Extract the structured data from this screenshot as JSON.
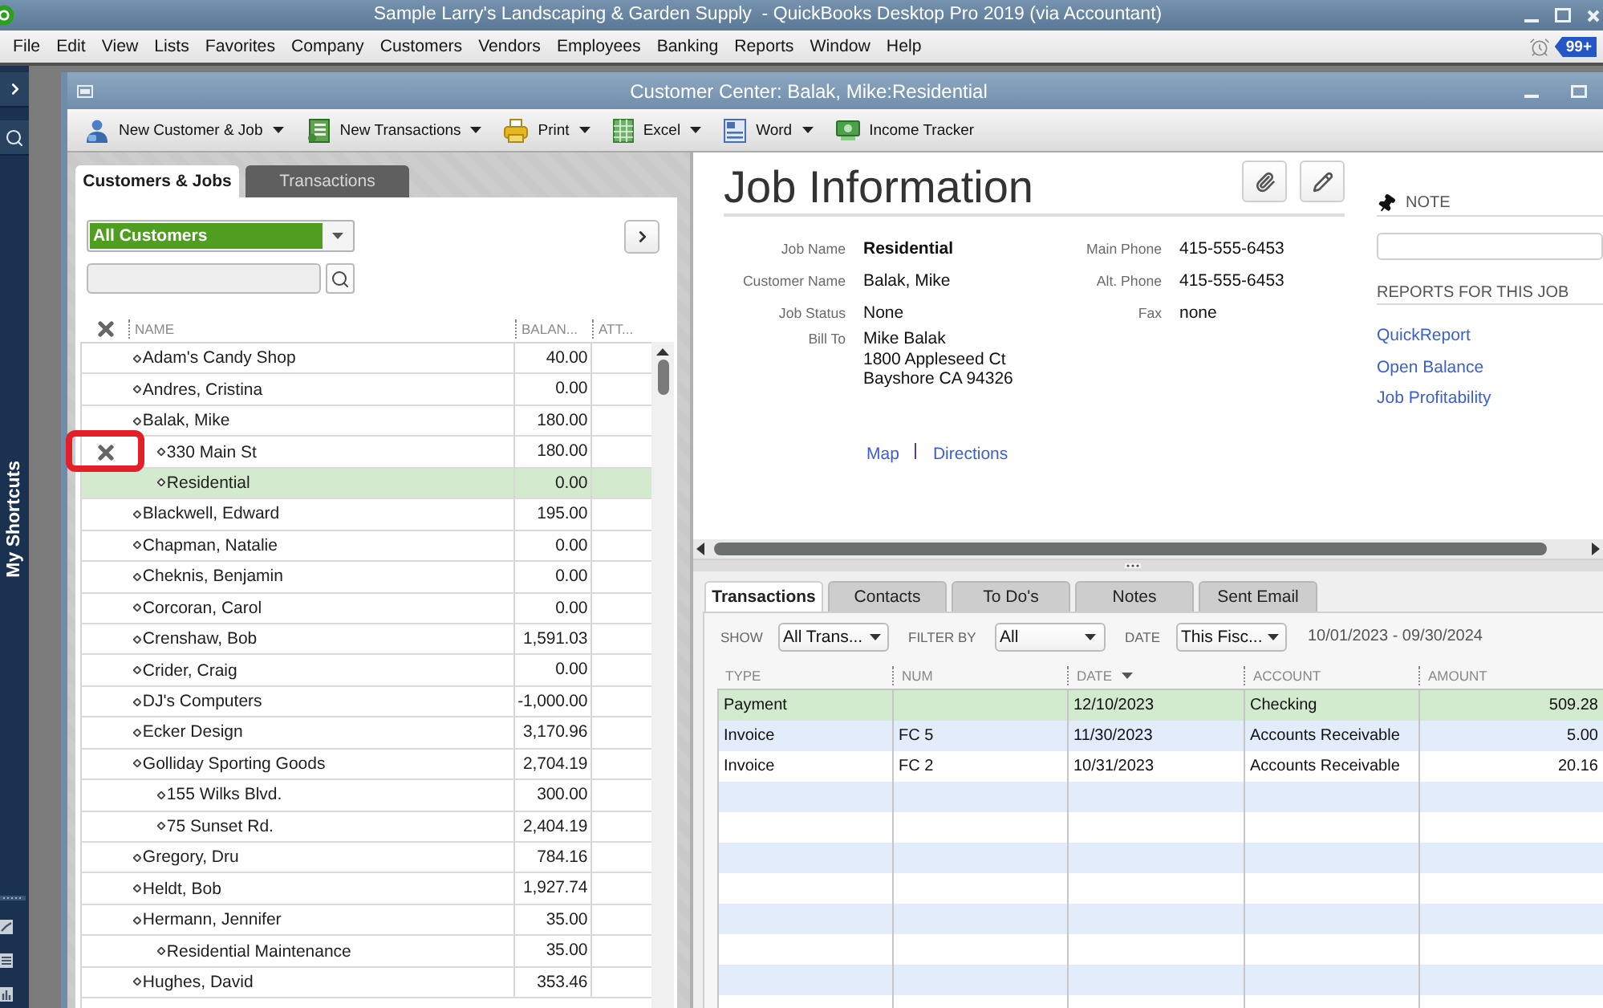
{
  "window": {
    "title": "Sample Larry's Landscaping & Garden Supply  - QuickBooks Desktop Pro 2019 (via Accountant)"
  },
  "menu_bar": {
    "items": [
      "File",
      "Edit",
      "View",
      "Lists",
      "Favorites",
      "Company",
      "Customers",
      "Vendors",
      "Employees",
      "Banking",
      "Reports",
      "Window",
      "Help"
    ],
    "reminders_badge": "99+"
  },
  "shortcuts_panel": {
    "label": "My Shortcuts"
  },
  "customer_center": {
    "title": "Customer Center: Balak, Mike:Residential",
    "toolbar": [
      {
        "kind": "customer",
        "label": "New Customer & Job",
        "dropdown": true
      },
      {
        "kind": "transactions",
        "label": "New Transactions",
        "dropdown": true
      },
      {
        "kind": "print",
        "label": "Print",
        "dropdown": true
      },
      {
        "kind": "excel",
        "label": "Excel",
        "dropdown": true
      },
      {
        "kind": "word",
        "label": "Word",
        "dropdown": true
      },
      {
        "kind": "income",
        "label": "Income Tracker",
        "dropdown": false
      }
    ]
  },
  "list_tabs": [
    {
      "label": "Customers & Jobs",
      "selected": true
    },
    {
      "label": "Transactions",
      "selected": false
    }
  ],
  "customer_filter": {
    "value": "All Customers"
  },
  "customer_table": {
    "columns": [
      "NAME",
      "BALAN...",
      "ATT..."
    ],
    "rows": [
      {
        "name": "Adam's Candy Shop",
        "balance": "40.00",
        "selected": false,
        "inactive": false,
        "marked": false
      },
      {
        "name": "Andres, Cristina",
        "balance": "0.00",
        "selected": false,
        "inactive": false,
        "marked": false
      },
      {
        "name": "Balak, Mike",
        "balance": "180.00",
        "selected": false,
        "inactive": false,
        "marked": false,
        "children": [
          {
            "name": "330 Main St",
            "balance": "180.00",
            "selected": false,
            "inactive": true,
            "marked": true
          },
          {
            "name": "Residential",
            "balance": "0.00",
            "selected": true,
            "inactive": false,
            "marked": false
          }
        ]
      },
      {
        "name": "Blackwell, Edward",
        "balance": "195.00",
        "selected": false,
        "inactive": false,
        "marked": false
      },
      {
        "name": "Chapman, Natalie",
        "balance": "0.00",
        "selected": false,
        "inactive": false,
        "marked": false
      },
      {
        "name": "Cheknis, Benjamin",
        "balance": "0.00",
        "selected": false,
        "inactive": false,
        "marked": false
      },
      {
        "name": "Corcoran, Carol",
        "balance": "0.00",
        "selected": false,
        "inactive": false,
        "marked": false
      },
      {
        "name": "Crenshaw, Bob",
        "balance": "1,591.03",
        "selected": false,
        "inactive": false,
        "marked": false
      },
      {
        "name": "Crider, Craig",
        "balance": "0.00",
        "selected": false,
        "inactive": false,
        "marked": false
      },
      {
        "name": "DJ's Computers",
        "balance": "-1,000.00",
        "selected": false,
        "inactive": false,
        "marked": false
      },
      {
        "name": "Ecker Design",
        "balance": "3,170.96",
        "selected": false,
        "inactive": false,
        "marked": false
      },
      {
        "name": "Golliday Sporting Goods",
        "balance": "2,704.19",
        "selected": false,
        "inactive": false,
        "marked": false,
        "children": [
          {
            "name": "155 Wilks Blvd.",
            "balance": "300.00",
            "selected": false,
            "inactive": false,
            "marked": false
          },
          {
            "name": "75 Sunset Rd.",
            "balance": "2,404.19",
            "selected": false,
            "inactive": false,
            "marked": false
          }
        ]
      },
      {
        "name": "Gregory, Dru",
        "balance": "784.16",
        "selected": false,
        "inactive": false,
        "marked": false
      },
      {
        "name": "Heldt, Bob",
        "balance": "1,927.74",
        "selected": false,
        "inactive": false,
        "marked": false
      },
      {
        "name": "Hermann, Jennifer",
        "balance": "35.00",
        "selected": false,
        "inactive": false,
        "marked": false,
        "children": [
          {
            "name": "Residential Maintenance",
            "balance": "35.00",
            "selected": false,
            "inactive": false,
            "marked": false
          }
        ]
      },
      {
        "name": "Hughes, David",
        "balance": "353.46",
        "selected": false,
        "inactive": false,
        "marked": false
      }
    ]
  },
  "job_information": {
    "heading": "Job Information",
    "details": [
      {
        "kind": "emphasis",
        "label": "Job Name",
        "value": "Residential"
      },
      {
        "kind": "plain",
        "label": "Customer Name",
        "value": "Balak, Mike"
      },
      {
        "kind": "plain",
        "label": "Job Status",
        "value": "None"
      },
      {
        "kind": "address",
        "label": "Bill To",
        "lines": [
          "Mike Balak",
          "1800 Appleseed Ct",
          "Bayshore CA 94326"
        ]
      }
    ],
    "contact": [
      {
        "label": "Main Phone",
        "value": "415-555-6453"
      },
      {
        "label": "Alt. Phone",
        "value": "415-555-6453"
      },
      {
        "label": "Fax",
        "value": "none"
      }
    ],
    "address_links": [
      "Map",
      "Directions"
    ]
  },
  "note": {
    "label": "NOTE"
  },
  "reports": {
    "heading": "REPORTS FOR THIS JOB",
    "links": [
      "QuickReport",
      "Open Balance",
      "Job Profitability"
    ]
  },
  "detail_tabs": [
    {
      "label": "Transactions",
      "selected": true
    },
    {
      "label": "Contacts",
      "selected": false
    },
    {
      "label": "To Do's",
      "selected": false
    },
    {
      "label": "Notes",
      "selected": false
    },
    {
      "label": "Sent Email",
      "selected": false
    }
  ],
  "transaction_filters": [
    {
      "label": "SHOW",
      "value": "All Trans..."
    },
    {
      "label": "FILTER BY",
      "value": "All"
    },
    {
      "label": "DATE",
      "value": "This Fisc..."
    }
  ],
  "date_range": "10/01/2023 - 09/30/2024",
  "transactions": {
    "columns": [
      {
        "label": "TYPE",
        "sorted": false
      },
      {
        "label": "NUM",
        "sorted": false
      },
      {
        "label": "DATE",
        "sorted": true
      },
      {
        "label": "ACCOUNT",
        "sorted": false
      },
      {
        "label": "AMOUNT",
        "sorted": false
      }
    ],
    "rows": [
      {
        "type": "Payment",
        "date": "12/10/2023",
        "account": "Checking",
        "amount": "509.28",
        "selected": true
      },
      {
        "type": "Invoice",
        "num": "FC 5",
        "date": "11/30/2023",
        "account": "Accounts Receivable",
        "amount": "5.00",
        "selected": false
      },
      {
        "type": "Invoice",
        "num": "FC 2",
        "date": "10/31/2023",
        "account": "Accounts Receivable",
        "amount": "20.16",
        "selected": false
      }
    ]
  }
}
